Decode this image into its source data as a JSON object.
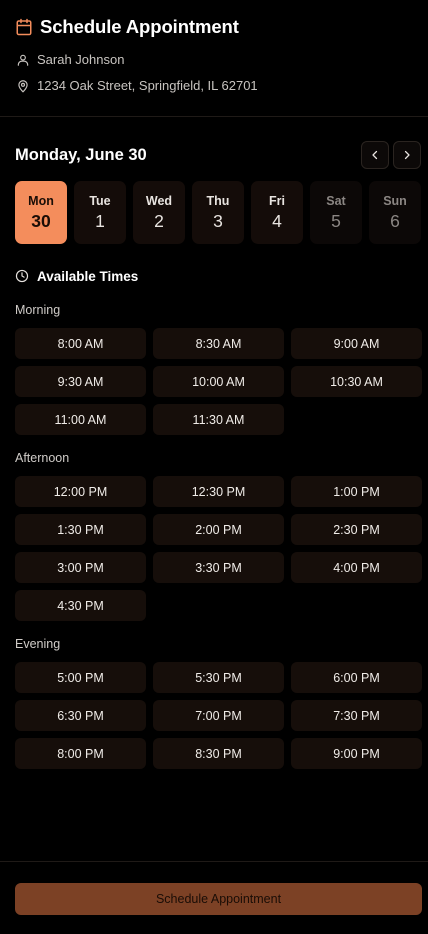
{
  "header": {
    "title": "Schedule Appointment",
    "icon": "calendar-icon",
    "person": "Sarah Johnson",
    "address": "1234 Oak Street, Springfield, IL 62701",
    "accent": "#f48d5c"
  },
  "date": {
    "label": "Monday, June 30"
  },
  "days": [
    {
      "dow": "Mon",
      "num": "30",
      "state": "active"
    },
    {
      "dow": "Tue",
      "num": "1",
      "state": "normal"
    },
    {
      "dow": "Wed",
      "num": "2",
      "state": "normal"
    },
    {
      "dow": "Thu",
      "num": "3",
      "state": "normal"
    },
    {
      "dow": "Fri",
      "num": "4",
      "state": "normal"
    },
    {
      "dow": "Sat",
      "num": "5",
      "state": "disabled"
    },
    {
      "dow": "Sun",
      "num": "6",
      "state": "disabled"
    }
  ],
  "available": {
    "title": "Available Times"
  },
  "sections": [
    {
      "label": "Morning",
      "slots": [
        "8:00 AM",
        "8:30 AM",
        "9:00 AM",
        "9:30 AM",
        "10:00 AM",
        "10:30 AM",
        "11:00 AM",
        "11:30 AM"
      ]
    },
    {
      "label": "Afternoon",
      "slots": [
        "12:00 PM",
        "12:30 PM",
        "1:00 PM",
        "1:30 PM",
        "2:00 PM",
        "2:30 PM",
        "3:00 PM",
        "3:30 PM",
        "4:00 PM",
        "4:30 PM"
      ]
    },
    {
      "label": "Evening",
      "slots": [
        "5:00 PM",
        "5:30 PM",
        "6:00 PM",
        "6:30 PM",
        "7:00 PM",
        "7:30 PM",
        "8:00 PM",
        "8:30 PM",
        "9:00 PM"
      ]
    }
  ],
  "footer": {
    "button_label": "Schedule Appointment"
  }
}
